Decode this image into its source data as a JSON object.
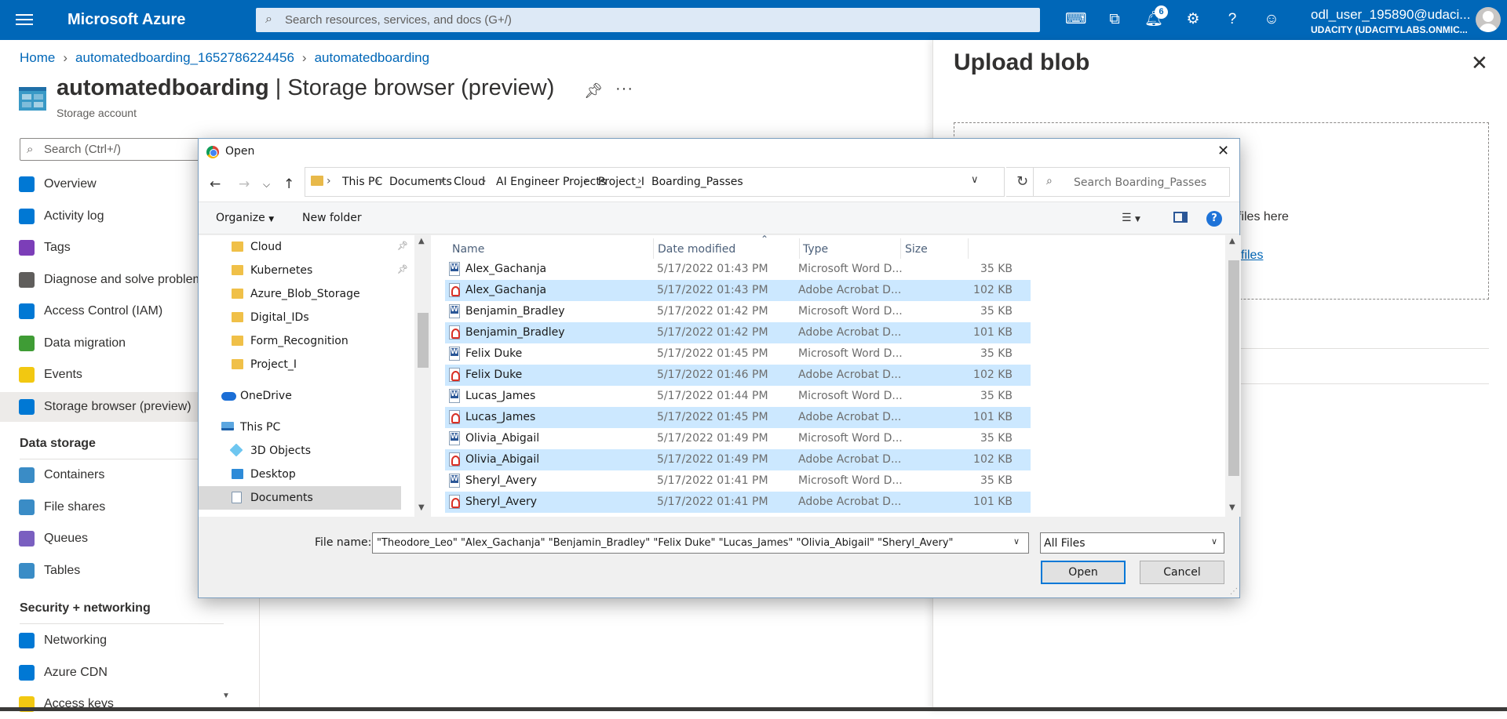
{
  "topbar": {
    "brand": "Microsoft Azure",
    "search_placeholder": "Search resources, services, and docs (G+/)",
    "notification_count": "6",
    "user_name": "odl_user_195890@udaci...",
    "user_tenant": "UDACITY (UDACITYLABS.ONMIC..."
  },
  "breadcrumb": [
    "Home",
    "automatedboarding_1652786224456",
    "automatedboarding"
  ],
  "header": {
    "resource_name": "automatedboarding",
    "page_name": "| Storage browser (preview)",
    "subtitle": "Storage account",
    "more": "···"
  },
  "nav": {
    "search_placeholder": "Search (Ctrl+/)",
    "items": [
      {
        "label": "Overview",
        "color": "#0078d4"
      },
      {
        "label": "Activity log",
        "color": "#0078d4"
      },
      {
        "label": "Tags",
        "color": "#7c3eb8"
      },
      {
        "label": "Diagnose and solve problems",
        "color": "#605e5c"
      },
      {
        "label": "Access Control (IAM)",
        "color": "#0078d4"
      },
      {
        "label": "Data migration",
        "color": "#3f9c35"
      },
      {
        "label": "Events",
        "color": "#f2c811"
      },
      {
        "label": "Storage browser (preview)",
        "color": "#0078d4"
      }
    ],
    "section_data_storage": "Data storage",
    "data_storage_items": [
      {
        "label": "Containers",
        "color": "#3a8cc6"
      },
      {
        "label": "File shares",
        "color": "#3a8cc6"
      },
      {
        "label": "Queues",
        "color": "#7a5fc0"
      },
      {
        "label": "Tables",
        "color": "#3a8cc6"
      }
    ],
    "section_security": "Security + networking",
    "security_items": [
      {
        "label": "Networking",
        "color": "#0078d4"
      },
      {
        "label": "Azure CDN",
        "color": "#0078d4"
      },
      {
        "label": "Access keys",
        "color": "#f2c811"
      }
    ]
  },
  "upload_panel": {
    "title": "Upload blob",
    "drop_text": "files here",
    "browse_link": "files"
  },
  "dialog": {
    "title": "Open",
    "path": [
      "This PC",
      "Documents",
      "Cloud",
      "AI Engineer Projects",
      "Project_I",
      "Boarding_Passes"
    ],
    "search_placeholder": "Search Boarding_Passes",
    "organize": "Organize",
    "new_folder": "New folder",
    "tree": [
      {
        "label": "Cloud",
        "icon": "folder",
        "pinned": true
      },
      {
        "label": "Kubernetes",
        "icon": "folder",
        "pinned": true
      },
      {
        "label": "Azure_Blob_Storage",
        "icon": "folder",
        "pinned": false
      },
      {
        "label": "Digital_IDs",
        "icon": "folder",
        "pinned": false
      },
      {
        "label": "Form_Recognition",
        "icon": "folder",
        "pinned": false
      },
      {
        "label": "Project_I",
        "icon": "folder",
        "pinned": false
      },
      {
        "label": "OneDrive",
        "icon": "cloud",
        "pinned": false
      },
      {
        "label": "This PC",
        "icon": "pc",
        "pinned": false
      },
      {
        "label": "3D Objects",
        "icon": "obj",
        "pinned": false
      },
      {
        "label": "Desktop",
        "icon": "desktop",
        "pinned": false
      },
      {
        "label": "Documents",
        "icon": "doc",
        "pinned": false
      }
    ],
    "columns": [
      "Name",
      "Date modified",
      "Type",
      "Size"
    ],
    "files": [
      {
        "name": "Alex_Gachanja",
        "date": "5/17/2022 01:43 PM",
        "type": "Microsoft Word D...",
        "size": "35 KB",
        "kind": "word",
        "selected": false
      },
      {
        "name": "Alex_Gachanja",
        "date": "5/17/2022 01:43 PM",
        "type": "Adobe Acrobat D...",
        "size": "102 KB",
        "kind": "pdf",
        "selected": true
      },
      {
        "name": "Benjamin_Bradley",
        "date": "5/17/2022 01:42 PM",
        "type": "Microsoft Word D...",
        "size": "35 KB",
        "kind": "word",
        "selected": false
      },
      {
        "name": "Benjamin_Bradley",
        "date": "5/17/2022 01:42 PM",
        "type": "Adobe Acrobat D...",
        "size": "101 KB",
        "kind": "pdf",
        "selected": true
      },
      {
        "name": "Felix Duke",
        "date": "5/17/2022 01:45 PM",
        "type": "Microsoft Word D...",
        "size": "35 KB",
        "kind": "word",
        "selected": false
      },
      {
        "name": "Felix Duke",
        "date": "5/17/2022 01:46 PM",
        "type": "Adobe Acrobat D...",
        "size": "102 KB",
        "kind": "pdf",
        "selected": true
      },
      {
        "name": "Lucas_James",
        "date": "5/17/2022 01:44 PM",
        "type": "Microsoft Word D...",
        "size": "35 KB",
        "kind": "word",
        "selected": false
      },
      {
        "name": "Lucas_James",
        "date": "5/17/2022 01:45 PM",
        "type": "Adobe Acrobat D...",
        "size": "101 KB",
        "kind": "pdf",
        "selected": true
      },
      {
        "name": "Olivia_Abigail",
        "date": "5/17/2022 01:49 PM",
        "type": "Microsoft Word D...",
        "size": "35 KB",
        "kind": "word",
        "selected": false
      },
      {
        "name": "Olivia_Abigail",
        "date": "5/17/2022 01:49 PM",
        "type": "Adobe Acrobat D...",
        "size": "102 KB",
        "kind": "pdf",
        "selected": true
      },
      {
        "name": "Sheryl_Avery",
        "date": "5/17/2022 01:41 PM",
        "type": "Microsoft Word D...",
        "size": "35 KB",
        "kind": "word",
        "selected": false
      },
      {
        "name": "Sheryl_Avery",
        "date": "5/17/2022 01:41 PM",
        "type": "Adobe Acrobat D...",
        "size": "101 KB",
        "kind": "pdf",
        "selected": true
      }
    ],
    "file_name_label": "File name:",
    "file_name_value": "\"Theodore_Leo\" \"Alex_Gachanja\" \"Benjamin_Bradley\" \"Felix Duke\" \"Lucas_James\" \"Olivia_Abigail\" \"Sheryl_Avery\"",
    "filter": "All Files",
    "open_button": "Open",
    "cancel_button": "Cancel"
  }
}
